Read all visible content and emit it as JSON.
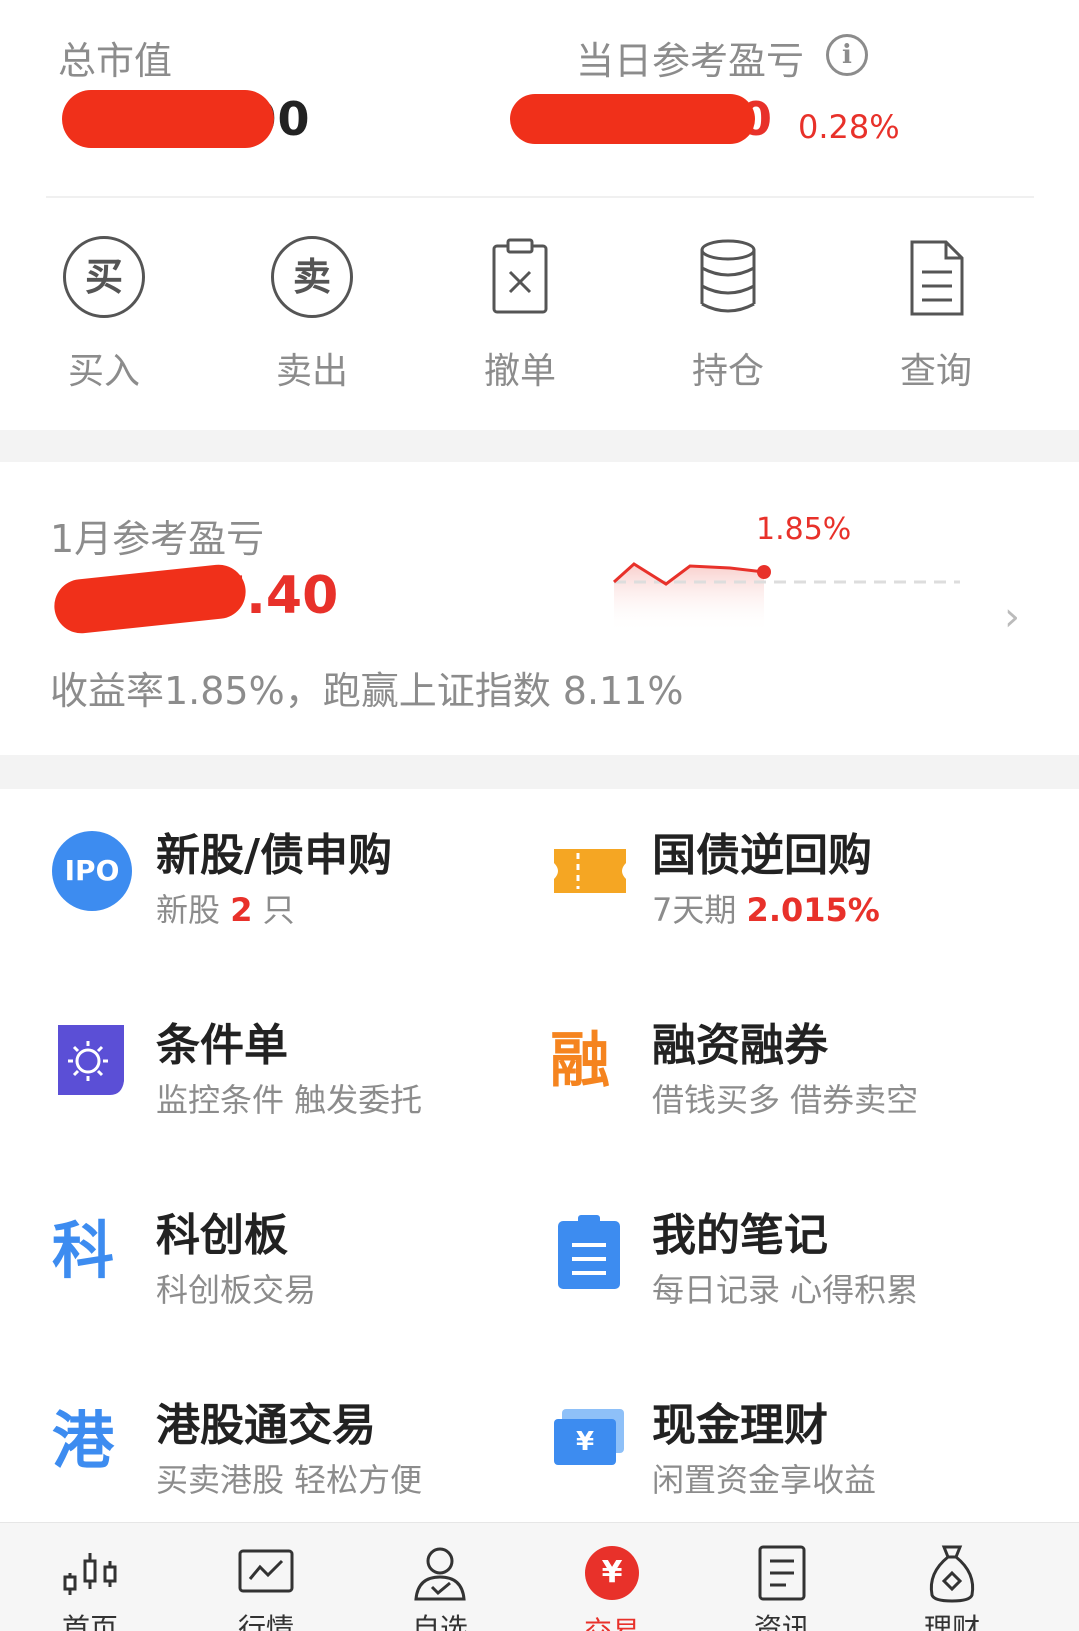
{
  "summary": {
    "total_value_label": "总市值",
    "total_value_visible": ".00",
    "daily_pnl_label": "当日参考盈亏",
    "daily_pnl_visible": "0",
    "daily_pnl_percent": "0.28%"
  },
  "actions": [
    {
      "label": "买入",
      "icon": "buy-circle-icon",
      "glyph": "买"
    },
    {
      "label": "卖出",
      "icon": "sell-circle-icon",
      "glyph": "卖"
    },
    {
      "label": "撤单",
      "icon": "cancel-order-icon"
    },
    {
      "label": "持仓",
      "icon": "holdings-database-icon"
    },
    {
      "label": "查询",
      "icon": "query-document-icon"
    }
  ],
  "month": {
    "title": "1月参考盈亏",
    "value_visible": "7.40",
    "chart_percent": "1.85%",
    "summary_text": "收益率1.85%，跑赢上证指数 8.11%"
  },
  "grid": [
    {
      "title": "新股/债申购",
      "sub_prefix": "新股 ",
      "sub_highlight": "2",
      "sub_suffix": " 只",
      "icon": "ipo-icon",
      "icon_text": "IPO"
    },
    {
      "title": "国债逆回购",
      "sub_prefix": "7天期 ",
      "sub_highlight": "2.015%",
      "sub_suffix": "",
      "icon": "ticket-icon"
    },
    {
      "title": "条件单",
      "sub_prefix": "监控条件 触发委托",
      "icon": "condition-order-icon"
    },
    {
      "title": "融资融券",
      "sub_prefix": "借钱买多 借券卖空",
      "icon": "margin-rong-icon",
      "icon_text": "融"
    },
    {
      "title": "科创板",
      "sub_prefix": "科创板交易",
      "icon": "star-market-ke-icon",
      "icon_text": "科"
    },
    {
      "title": "我的笔记",
      "sub_prefix": "每日记录 心得积累",
      "icon": "notes-clipboard-icon"
    },
    {
      "title": "港股通交易",
      "sub_prefix": "买卖港股 轻松方便",
      "icon": "hk-connect-gang-icon",
      "icon_text": "港"
    },
    {
      "title": "现金理财",
      "sub_prefix": "闲置资金享收益",
      "icon": "cash-wallet-icon",
      "icon_text": "¥"
    }
  ],
  "tabs": [
    {
      "label": "首页",
      "icon": "candlestick-icon"
    },
    {
      "label": "行情",
      "icon": "market-chart-icon"
    },
    {
      "label": "自选",
      "icon": "user-watchlist-icon"
    },
    {
      "label": "交易",
      "icon": "trade-yuan-icon",
      "glyph": "¥",
      "active": true
    },
    {
      "label": "资讯",
      "icon": "news-doc-icon"
    },
    {
      "label": "理财",
      "icon": "money-bag-icon"
    }
  ],
  "colors": {
    "accent": "#e8312a",
    "ipo_blue": "#3d8cf0",
    "orange": "#f5a623",
    "purple": "#5b4fd6",
    "text_gray": "#8c8c8c"
  }
}
